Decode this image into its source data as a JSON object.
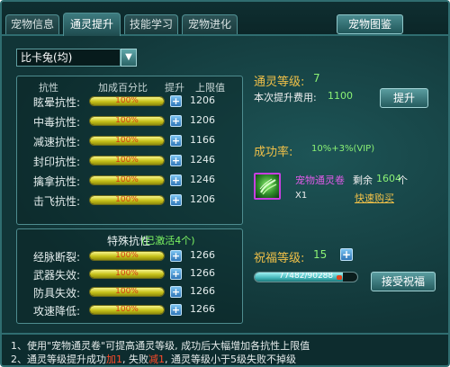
{
  "tabs": [
    {
      "label": "宠物信息"
    },
    {
      "label": "通灵提升"
    },
    {
      "label": "技能学习"
    },
    {
      "label": "宠物进化"
    }
  ],
  "pedia_button": "宠物图鉴",
  "pet_select": {
    "value": "比卡兔(均)"
  },
  "resist_panel": {
    "headers": {
      "name": "抗性",
      "percent": "加成百分比",
      "up": "提升",
      "max": "上限值"
    },
    "rows": [
      {
        "label": "眩晕抗性:",
        "percent": "100%",
        "max": "1206"
      },
      {
        "label": "中毒抗性:",
        "percent": "100%",
        "max": "1206"
      },
      {
        "label": "减速抗性:",
        "percent": "100%",
        "max": "1166"
      },
      {
        "label": "封印抗性:",
        "percent": "100%",
        "max": "1246"
      },
      {
        "label": "擒拿抗性:",
        "percent": "100%",
        "max": "1246"
      },
      {
        "label": "击飞抗性:",
        "percent": "100%",
        "max": "1206"
      }
    ]
  },
  "special_panel": {
    "title": "特殊抗性",
    "active": "(已激活4个)",
    "rows": [
      {
        "label": "经脉断裂:",
        "percent": "100%",
        "max": "1266"
      },
      {
        "label": "武器失效:",
        "percent": "100%",
        "max": "1266"
      },
      {
        "label": "防具失效:",
        "percent": "100%",
        "max": "1266"
      },
      {
        "label": "攻速降低:",
        "percent": "100%",
        "max": "1266"
      }
    ]
  },
  "level": {
    "label": "通灵等级:",
    "value": "7",
    "cost_label": "本次提升费用:",
    "cost_value": "1100",
    "button": "提升"
  },
  "success": {
    "label": "成功率:",
    "value": "10%+3%(VIP)"
  },
  "item": {
    "name": "宠物通灵卷",
    "remain_label": "剩余",
    "remain_value": "1604",
    "remain_unit": "个",
    "qty": "X1",
    "buy_link": "快速购买",
    "icon": "scroll-icon"
  },
  "bless": {
    "label": "祝福等级:",
    "value": "15",
    "progress_text": "77482/90288",
    "progress": 0.858,
    "button": "接受祝福"
  },
  "notes": {
    "n1": "1、使用\"宠物通灵卷\"可提高通灵等级, 成功后大幅增加各抗性上限值",
    "n2_a": "2、通灵等级提升成功",
    "n2_b": "加1",
    "n2_c": ", 失败",
    "n2_d": "减1",
    "n2_e": ", 通灵等级小于5级失败不掉级"
  },
  "colors": {
    "accent": "#f0c048",
    "value_green": "#8bf275",
    "bar_yellow": "#f7f48a",
    "item_purple": "#e05ae8"
  }
}
